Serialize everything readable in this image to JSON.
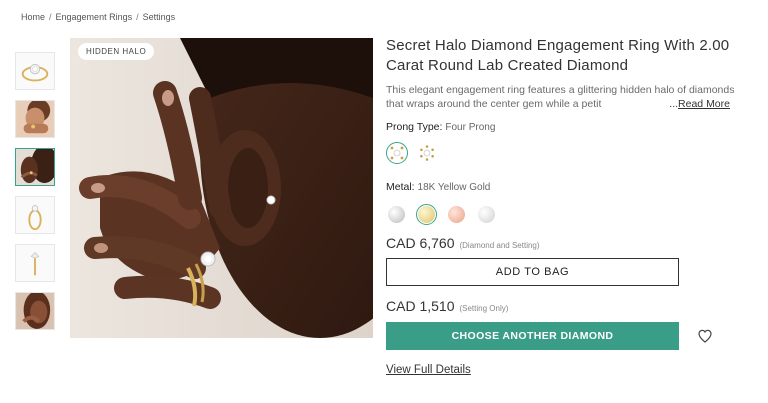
{
  "breadcrumb": {
    "items": [
      "Home",
      "Engagement Rings",
      "Settings"
    ],
    "separator": "/"
  },
  "gallery": {
    "thumbnails": [
      {
        "kind": "ring-top-view",
        "active": false
      },
      {
        "kind": "hand-model",
        "active": false
      },
      {
        "kind": "earring-hand",
        "active": true
      },
      {
        "kind": "ring-side-view",
        "active": false
      },
      {
        "kind": "ring-profile",
        "active": false
      },
      {
        "kind": "face-model",
        "active": false
      }
    ],
    "hero_badge": "HIDDEN HALO"
  },
  "product": {
    "title": "Secret Halo Diamond Engagement Ring With 2.00 Carat Round Lab Created Diamond",
    "description": "This elegant engagement ring features a glittering hidden halo of diamonds that wraps around the center gem while a petit",
    "read_more_prefix": "...",
    "read_more": "Read More"
  },
  "prong": {
    "label": "Prong Type:",
    "value": "Four Prong",
    "options": [
      {
        "name": "four-prong",
        "active": true
      },
      {
        "name": "six-prong",
        "active": false
      }
    ]
  },
  "metal": {
    "label": "Metal:",
    "value": "18K Yellow Gold",
    "options": [
      {
        "name": "white-gold",
        "color": "#d9d9d9",
        "active": false
      },
      {
        "name": "yellow-gold",
        "color": "#e8d38a",
        "active": true
      },
      {
        "name": "rose-gold",
        "color": "#f0b6a0",
        "active": false
      },
      {
        "name": "platinum",
        "color": "#e0e0e0",
        "active": false
      }
    ]
  },
  "pricing": {
    "total": "CAD 6,760",
    "total_note": "(Diamond and Setting)",
    "setting": "CAD 1,510",
    "setting_note": "(Setting Only)"
  },
  "actions": {
    "add_to_bag": "ADD TO BAG",
    "choose_diamond": "CHOOSE ANOTHER DIAMOND",
    "wishlist_icon": "heart-icon",
    "full_details": "View Full Details"
  },
  "colors": {
    "accent": "#3a9d88",
    "text": "#333333",
    "muted": "#6b6b6b"
  }
}
